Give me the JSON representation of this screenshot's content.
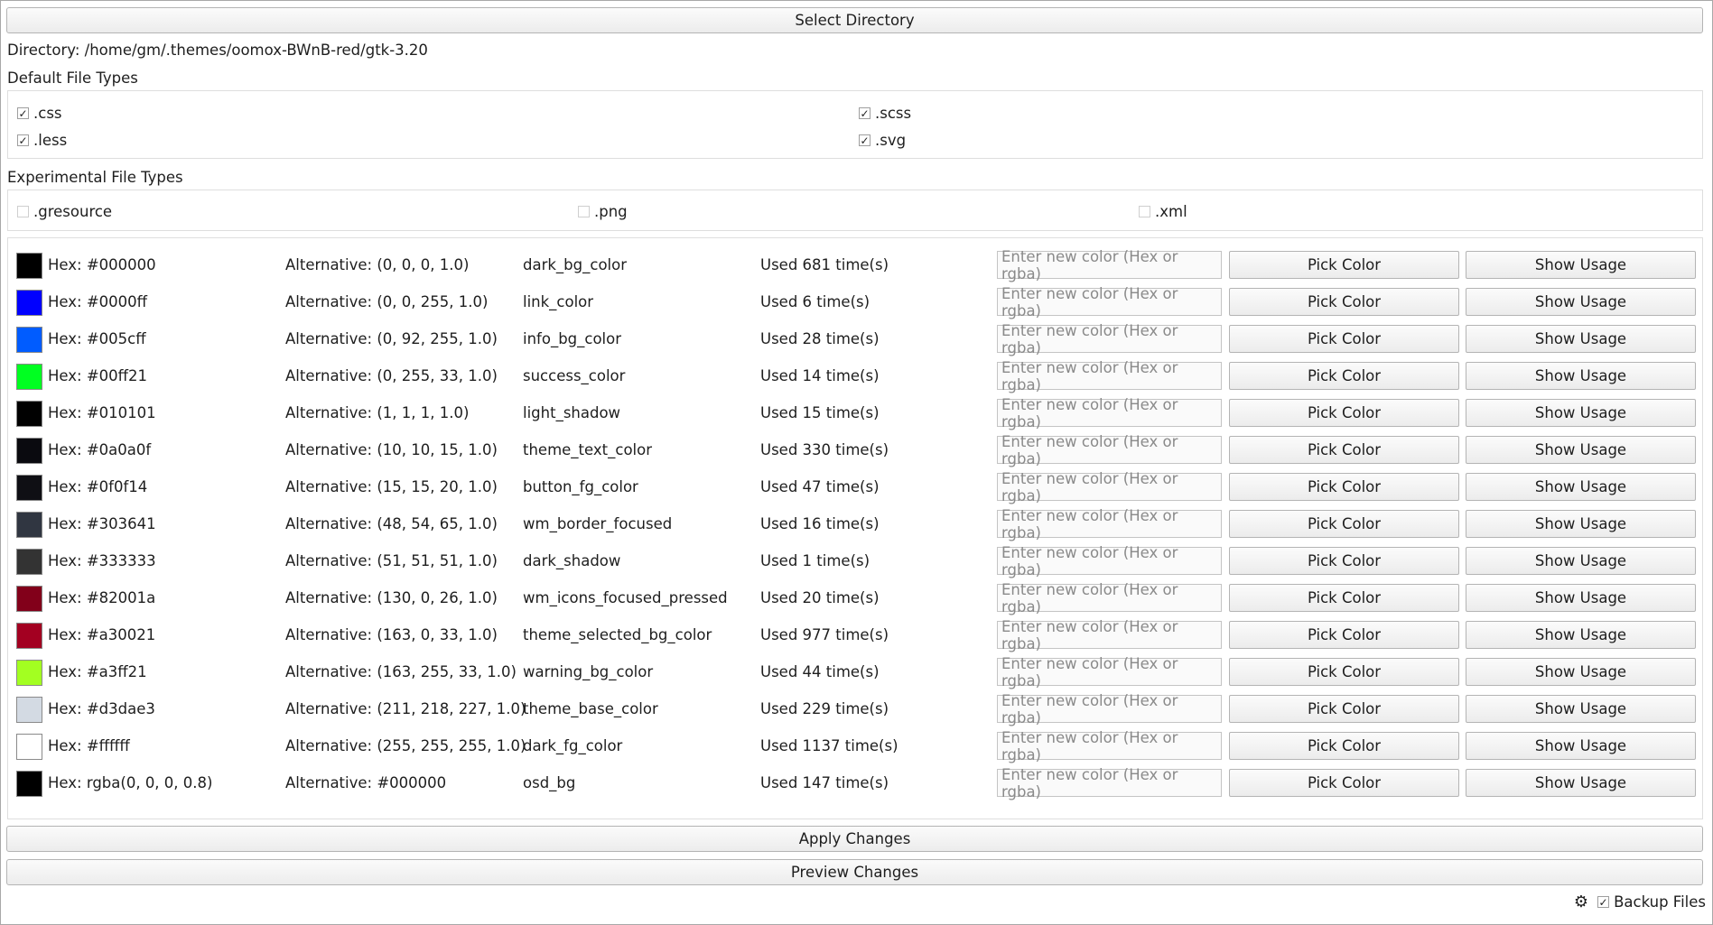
{
  "toolbar": {
    "select_directory_label": "Select Directory"
  },
  "directory_text": "Directory: /home/gm/.themes/oomox-BWnB-red/gtk-3.20",
  "default_types": {
    "title": "Default File Types",
    "items": [
      {
        "label": ".css",
        "checked": true
      },
      {
        "label": ".scss",
        "checked": true
      },
      {
        "label": ".less",
        "checked": true
      },
      {
        "label": ".svg",
        "checked": true
      }
    ]
  },
  "experimental_types": {
    "title": "Experimental File Types",
    "items": [
      {
        "label": ".gresource",
        "checked": false
      },
      {
        "label": ".png",
        "checked": false
      },
      {
        "label": ".xml",
        "checked": false
      }
    ]
  },
  "input_placeholder": "Enter new color (Hex or rgba)",
  "pick_label": "Pick Color",
  "usage_label": "Show Usage",
  "colors": [
    {
      "swatch": "#000000",
      "hex": "Hex: #000000",
      "alt": "Alternative: (0, 0, 0, 1.0)",
      "name": "dark_bg_color",
      "used": "Used 681 time(s)"
    },
    {
      "swatch": "#0000ff",
      "hex": "Hex: #0000ff",
      "alt": "Alternative: (0, 0, 255, 1.0)",
      "name": "link_color",
      "used": "Used 6 time(s)"
    },
    {
      "swatch": "#005cff",
      "hex": "Hex: #005cff",
      "alt": "Alternative: (0, 92, 255, 1.0)",
      "name": "info_bg_color",
      "used": "Used 28 time(s)"
    },
    {
      "swatch": "#00ff21",
      "hex": "Hex: #00ff21",
      "alt": "Alternative: (0, 255, 33, 1.0)",
      "name": "success_color",
      "used": "Used 14 time(s)"
    },
    {
      "swatch": "#010101",
      "hex": "Hex: #010101",
      "alt": "Alternative: (1, 1, 1, 1.0)",
      "name": "light_shadow",
      "used": "Used 15 time(s)"
    },
    {
      "swatch": "#0a0a0f",
      "hex": "Hex: #0a0a0f",
      "alt": "Alternative: (10, 10, 15, 1.0)",
      "name": "theme_text_color",
      "used": "Used 330 time(s)"
    },
    {
      "swatch": "#0f0f14",
      "hex": "Hex: #0f0f14",
      "alt": "Alternative: (15, 15, 20, 1.0)",
      "name": "button_fg_color",
      "used": "Used 47 time(s)"
    },
    {
      "swatch": "#303641",
      "hex": "Hex: #303641",
      "alt": "Alternative: (48, 54, 65, 1.0)",
      "name": "wm_border_focused",
      "used": "Used 16 time(s)"
    },
    {
      "swatch": "#333333",
      "hex": "Hex: #333333",
      "alt": "Alternative: (51, 51, 51, 1.0)",
      "name": "dark_shadow",
      "used": "Used 1 time(s)"
    },
    {
      "swatch": "#82001a",
      "hex": "Hex: #82001a",
      "alt": "Alternative: (130, 0, 26, 1.0)",
      "name": "wm_icons_focused_pressed",
      "used": "Used 20 time(s)"
    },
    {
      "swatch": "#a30021",
      "hex": "Hex: #a30021",
      "alt": "Alternative: (163, 0, 33, 1.0)",
      "name": "theme_selected_bg_color",
      "used": "Used 977 time(s)"
    },
    {
      "swatch": "#a3ff21",
      "hex": "Hex: #a3ff21",
      "alt": "Alternative: (163, 255, 33, 1.0)",
      "name": "warning_bg_color",
      "used": "Used 44 time(s)"
    },
    {
      "swatch": "#d3dae3",
      "hex": "Hex: #d3dae3",
      "alt": "Alternative: (211, 218, 227, 1.0)",
      "name": "theme_base_color",
      "used": "Used 229 time(s)"
    },
    {
      "swatch": "#ffffff",
      "hex": "Hex: #ffffff",
      "alt": "Alternative: (255, 255, 255, 1.0)",
      "name": "dark_fg_color",
      "used": "Used 1137 time(s)"
    },
    {
      "swatch": "#000000",
      "hex": "Hex: rgba(0, 0, 0, 0.8)",
      "alt": "Alternative: #000000",
      "name": "osd_bg",
      "used": "Used 147 time(s)"
    }
  ],
  "actions": {
    "apply_label": "Apply Changes",
    "preview_label": "Preview Changes"
  },
  "footer": {
    "settings_icon": "gear-icon",
    "backup_label": "Backup Files",
    "backup_checked": true
  }
}
